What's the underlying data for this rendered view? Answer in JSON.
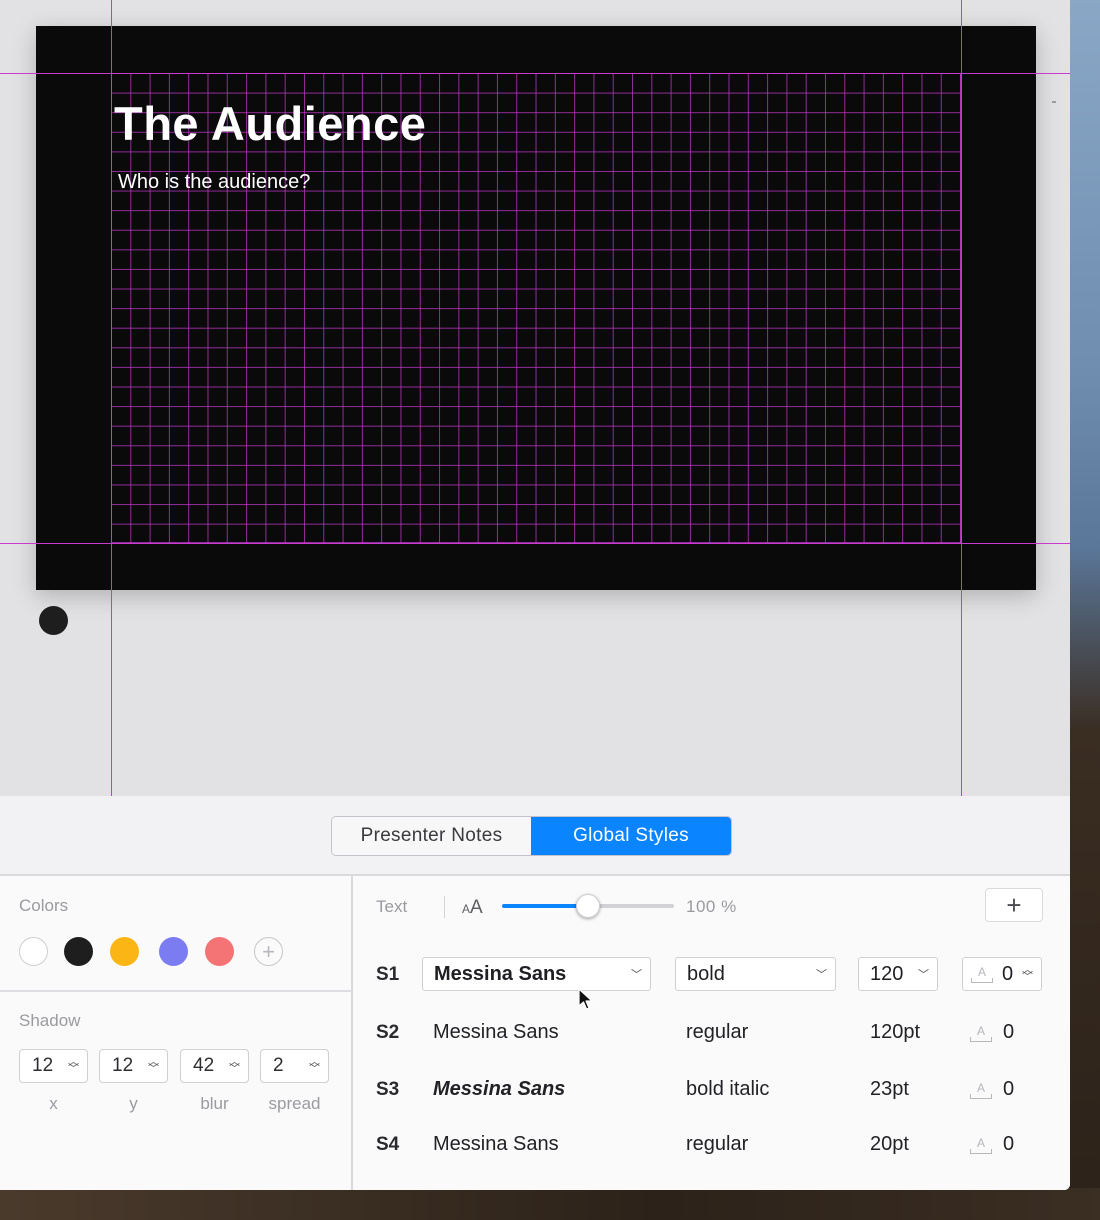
{
  "slide": {
    "title": "The Audience",
    "subtitle": "Who is the audience?"
  },
  "tabs": {
    "presenter_notes": "Presenter Notes",
    "global_styles": "Global Styles",
    "active": "Global Styles"
  },
  "colors": {
    "label": "Colors",
    "swatches": [
      "#ffffff",
      "#1e1e1f",
      "#fbb615",
      "#7b7cf2",
      "#f47375"
    ],
    "add_icon": "plus-circle-icon"
  },
  "shadow": {
    "label": "Shadow",
    "fields": [
      {
        "value": "12",
        "caption": "x"
      },
      {
        "value": "12",
        "caption": "y"
      },
      {
        "value": "42",
        "caption": "blur"
      },
      {
        "value": "2",
        "caption": "spread"
      }
    ]
  },
  "text": {
    "label": "Text",
    "size_icon": "font-size-icon",
    "scale_percent_value": 100,
    "scale_label": "100 %",
    "add_icon": "plus-icon"
  },
  "styles": [
    {
      "id": "S1",
      "font": "Messina Sans",
      "weight": "bold",
      "size": "120",
      "tracking": "0"
    },
    {
      "id": "S2",
      "font": "Messina Sans",
      "weight": "regular",
      "size": "120pt",
      "tracking": "0"
    },
    {
      "id": "S3",
      "font": "Messina Sans",
      "weight": "bold italic",
      "size": "23pt",
      "tracking": "0"
    },
    {
      "id": "S4",
      "font": "Messina Sans",
      "weight": "regular",
      "size": "20pt",
      "tracking": "0"
    }
  ],
  "accent": "#0a84ff",
  "guide_color": "#c73ccf"
}
